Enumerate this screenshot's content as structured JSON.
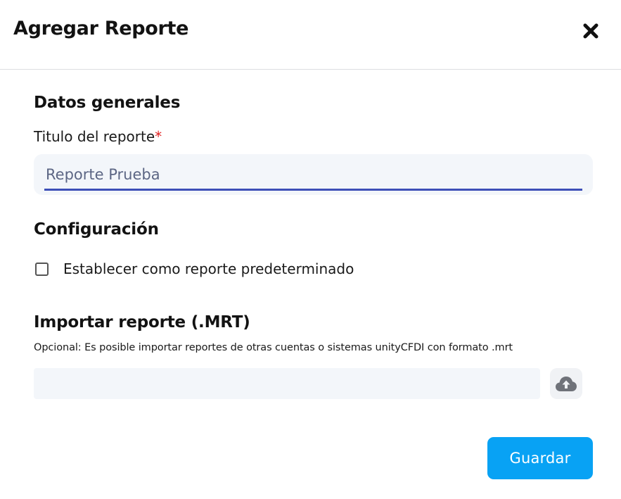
{
  "dialog": {
    "title": "Agregar Reporte",
    "close_icon": "close-icon"
  },
  "general": {
    "heading": "Datos generales",
    "report_title_label": "Titulo del reporte",
    "required_mark": "*",
    "report_title_value": "Reporte Prueba"
  },
  "config": {
    "heading": "Configuración",
    "default_checkbox_label": "Establecer como reporte predeterminado",
    "default_checked": false
  },
  "import": {
    "heading": "Importar reporte (.MRT)",
    "hint": "Opcional: Es posible importar reportes de otras cuentas o sistemas unityCFDI con formato .mrt",
    "file_value": "",
    "upload_icon": "cloud-upload-icon"
  },
  "actions": {
    "save_label": "Guardar"
  },
  "colors": {
    "primary": "#08a2f4",
    "input_underline": "#3d4fb8",
    "required": "#e02020",
    "input_bg": "#f3f6fa"
  }
}
